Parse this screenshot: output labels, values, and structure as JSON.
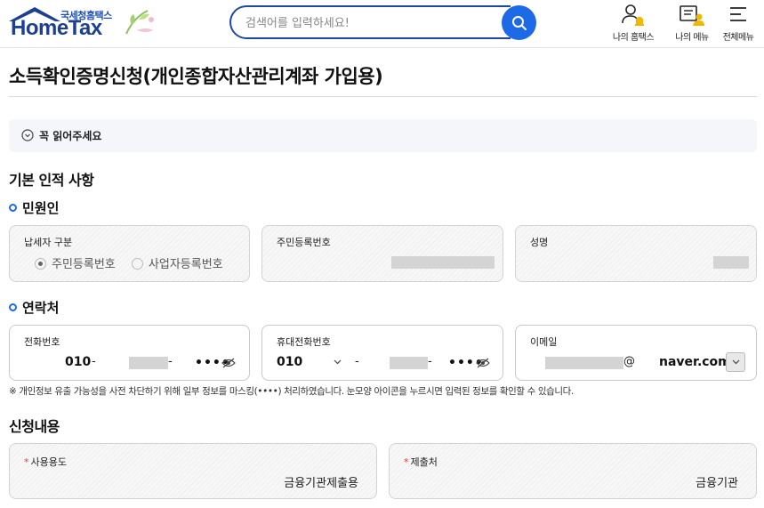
{
  "header": {
    "logo_sub": "국세청홈택스",
    "logo_main": "HomeTax",
    "search_placeholder": "검색어를 입력하세요!",
    "nav": [
      {
        "label": "나의 홈택스",
        "icon": "user-bell-icon"
      },
      {
        "label": "나의 메뉴",
        "icon": "menu-person-icon"
      },
      {
        "label": "전체메뉴",
        "icon": "hamburger-icon"
      }
    ]
  },
  "page": {
    "title": "소득확인증명신청(개인종합자산관리계좌 가입용)",
    "notice": "꼭 읽어주세요"
  },
  "basic_info": {
    "section_title": "기본 인적 사항",
    "applicant": {
      "title": "민원인",
      "taxpayer_type_label": "납세자 구분",
      "options": [
        "주민등록번호",
        "사업자등록번호"
      ],
      "selected": "주민등록번호",
      "rrn_label": "주민등록번호",
      "name_label": "성명"
    },
    "contact": {
      "title": "연락처",
      "phone_label": "전화번호",
      "phone_prefix": "010",
      "phone_dash1": "-",
      "phone_dash2": "-",
      "phone_last": "••••",
      "mobile_label": "휴대전화번호",
      "mobile_prefix": "010",
      "mobile_dash1": "-",
      "mobile_dash2": "-",
      "mobile_last": "••••",
      "email_label": "이메일",
      "email_at": "@",
      "email_domain": "naver.com"
    },
    "privacy_note": "※ 개인정보 유출 가능성을 사전 차단하기 위해 일부 정보를 마스킹(••••) 처리하였습니다. 눈모양 아이콘을 누르시면 입력된 정보를 확인할 수 있습니다."
  },
  "application": {
    "section_title": "신청내용",
    "purpose_label": "사용용도",
    "purpose_value": "금융기관제출용",
    "submit_to_label": "제출처",
    "submit_to_value": "금융기관",
    "required_mark": "*"
  },
  "colors": {
    "brand_blue": "#1c3f94",
    "accent_blue": "#1e6ae6",
    "required_red": "#e03b3b"
  }
}
